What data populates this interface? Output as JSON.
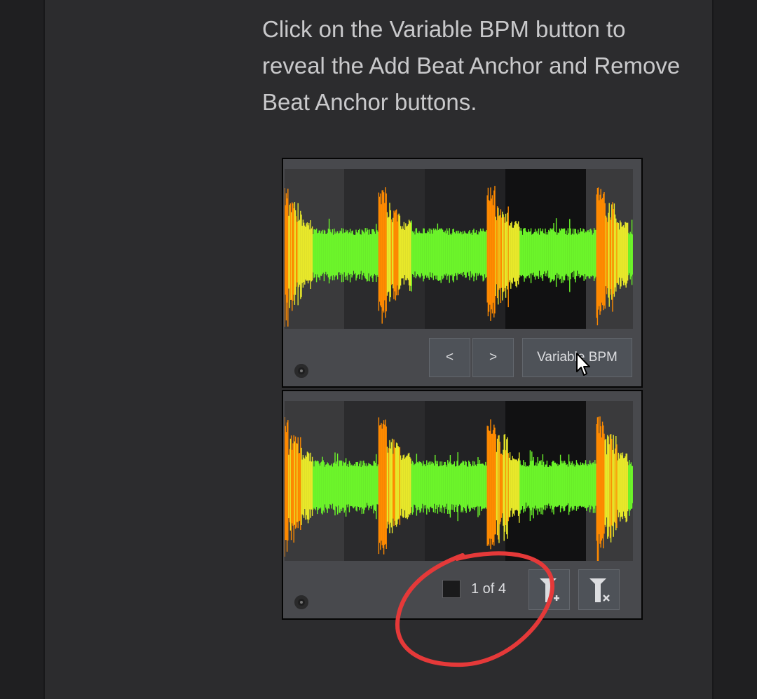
{
  "instruction_text": "Click on the Variable BPM button to reveal the Add Beat Anchor and Remove Beat Anchor buttons.",
  "top_panel": {
    "prev_label": "<",
    "next_label": ">",
    "variable_bpm_label": "Variable BPM"
  },
  "bottom_panel": {
    "beat_anchor_count": "1 of 4",
    "add_anchor_icon": "add-beat-anchor-icon",
    "remove_anchor_icon": "remove-beat-anchor-icon"
  },
  "colors": {
    "page_background": "#1f1f21",
    "column_background": "#2c2c2e",
    "panel_background": "#48494d",
    "waveform_peak": "#ff8a00",
    "waveform_mid": "#e8e82a",
    "waveform_body": "#6cf52a",
    "annotation_circle": "#e53939"
  }
}
